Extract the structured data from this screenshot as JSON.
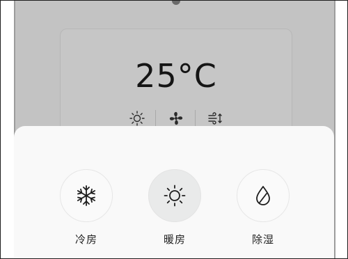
{
  "status": {
    "temperature": "25°C"
  },
  "modes": [
    {
      "label": "冷房",
      "icon": "snowflake-icon"
    },
    {
      "label": "暖房",
      "icon": "sun-icon",
      "selected": true
    },
    {
      "label": "除湿",
      "icon": "water-drop-icon"
    }
  ],
  "colors": {
    "backdrop": "#c3c3c3",
    "sheet": "#f9f9f9",
    "selected_mode_bg": "#e9eaea",
    "text": "#151515"
  }
}
